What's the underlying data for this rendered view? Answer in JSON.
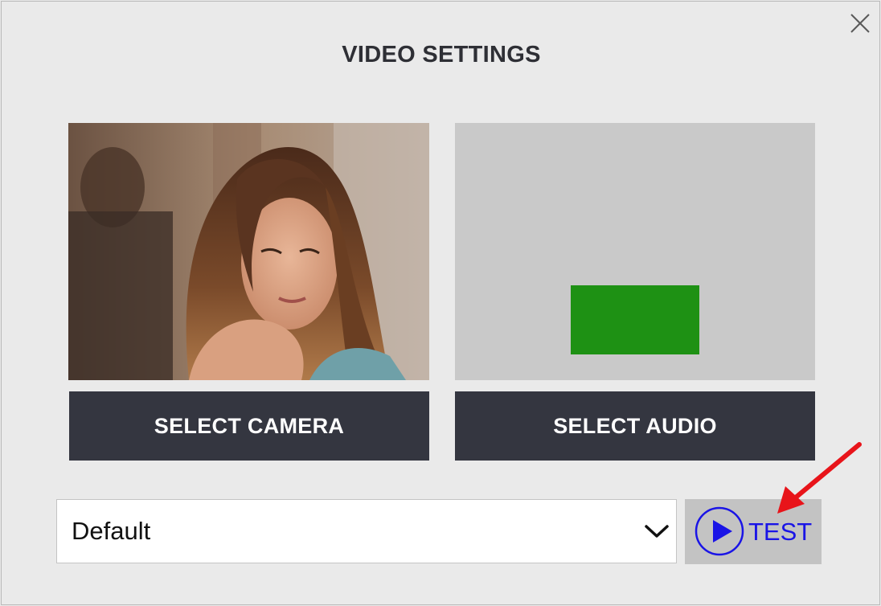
{
  "dialog": {
    "title": "VIDEO SETTINGS",
    "close_icon": "close-icon"
  },
  "camera": {
    "button_label": "SELECT CAMERA",
    "preview": "webcam-preview-image"
  },
  "audio": {
    "button_label": "SELECT AUDIO",
    "level_color": "#1e9114"
  },
  "device_select": {
    "value": "Default",
    "icon": "chevron-down-icon"
  },
  "test": {
    "label": "TEST",
    "icon": "play-circle-icon",
    "color": "#1a14e6"
  },
  "annotation": {
    "icon": "red-arrow-icon",
    "color": "#e8141a"
  }
}
